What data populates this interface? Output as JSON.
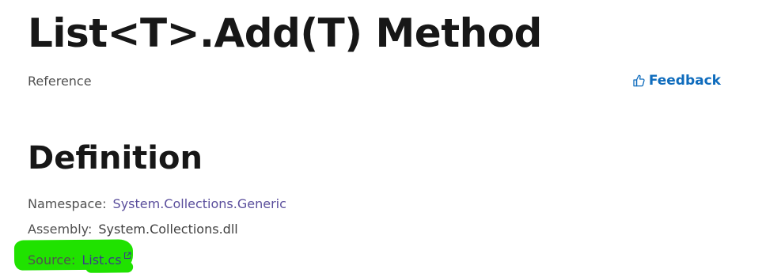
{
  "header": {
    "title": "List<T>.Add(T) Method",
    "topic_type": "Reference",
    "feedback_label": "Feedback",
    "feedback_icon": "thumbs-up-icon"
  },
  "definition": {
    "heading": "Definition",
    "namespace_label": "Namespace:",
    "namespace_value": "System.Collections.Generic",
    "assembly_label": "Assembly:",
    "assembly_value": "System.Collections.dll",
    "source_label": "Source:",
    "source_value": "List.cs",
    "source_icon": "external-link-icon"
  },
  "colors": {
    "link": "#0f6cbd",
    "highlight": "#20e200"
  }
}
